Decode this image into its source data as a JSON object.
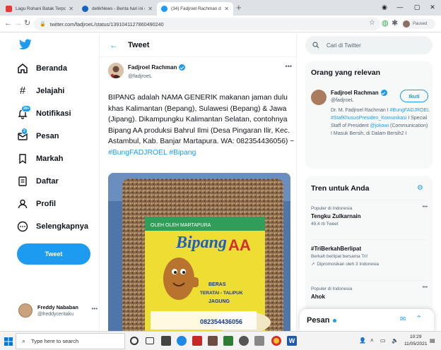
{
  "browser": {
    "tabs": [
      {
        "title": "Lagu Rohani Batak Terpopuler sa",
        "favicon_color": "#e53935",
        "active": false
      },
      {
        "title": "detikNews - Berita hari ini di Indo",
        "favicon_color": "#1565c0",
        "active": false
      },
      {
        "title": "(34) Fadjroel Rachman di Twitter",
        "favicon_color": "#1d9bf0",
        "active": true
      }
    ],
    "new_tab": "+",
    "address": "twitter.com/fadjroeL/status/1391041127860490240",
    "profile_label": "Paused"
  },
  "nav": {
    "items": [
      {
        "label": "Beranda",
        "icon": "home-icon"
      },
      {
        "label": "Jelajahi",
        "icon": "hashtag-icon"
      },
      {
        "label": "Notifikasi",
        "icon": "bell-icon",
        "badge": "20+"
      },
      {
        "label": "Pesan",
        "icon": "mail-icon",
        "badge": "2"
      },
      {
        "label": "Markah",
        "icon": "bookmark-icon"
      },
      {
        "label": "Daftar",
        "icon": "list-icon"
      },
      {
        "label": "Profil",
        "icon": "person-icon"
      },
      {
        "label": "Selengkapnya",
        "icon": "more-circle-icon"
      }
    ],
    "tweet_button": "Tweet",
    "account": {
      "name": "Freddy Nababan",
      "handle": "@freddyceritaku"
    }
  },
  "main": {
    "title": "Tweet",
    "author": {
      "name": "Fadjroel Rachman",
      "handle": "@fadjroeL"
    },
    "text_plain": "BIPANG adalah NAMA GENERIK makanan jaman dulu khas Kalimantan (Bepang), Sulawesi (Bepang) & Jawa (Jipang). Dikampungku Kalimantan Selatan, contohnya Bipang AA produksi Bahrul Ilmi (Desa Pingaran Ilir, Kec. Astambul, Kab. Banjar Martapura. WA: 082354436056) ~ ",
    "hashtags": [
      "#BungFADJROEL",
      "#Bipang"
    ],
    "image": {
      "brand": "Bipang",
      "brand_sub": "AA",
      "small_top": "OLEH OLEH MARTAPURA",
      "lines": [
        "BERAS",
        "TERATAI - TALIPUK",
        "JAGUNG"
      ],
      "phone": "082354436056"
    }
  },
  "right": {
    "search_placeholder": "Cari di Twitter",
    "relevant": {
      "header": "Orang yang relevan",
      "name": "Fadjroel Rachman",
      "handle": "@fadjroeL",
      "follow": "Ikuti",
      "bio_pre": "Dr. M. Fadjroel Rachman I ",
      "bio_tag1": "#BungFADJROEL",
      "bio_tag2": "#StafKhususPresiden_Komunikasi",
      "bio_mid": " I Special Staff of President ",
      "bio_mention": "@jokowi",
      "bio_post": " (Communication) I Masuk Bersih, di Dalam Bersih2 I"
    },
    "trends": {
      "header": "Tren untuk Anda",
      "items": [
        {
          "context": "Populer di Indonesia",
          "name": "Tengku Zulkarnain",
          "count": "49,4 rb Tweet"
        },
        {
          "context": "",
          "name": "#TriBerkahBerlipat",
          "desc": "Berkah berlipat bersama Tri!",
          "promo": "Dipromosikan oleh 3 Indonesia"
        },
        {
          "context": "Populer di Indonesia",
          "name": "Ahok",
          "count": ""
        }
      ]
    },
    "dm": {
      "label": "Pesan"
    }
  },
  "taskbar": {
    "search": "Type here to search",
    "time": "10:29",
    "date": "11/05/2021"
  },
  "colors": {
    "accent": "#1d9bf0",
    "text": "#0f1419",
    "muted": "#536471"
  }
}
